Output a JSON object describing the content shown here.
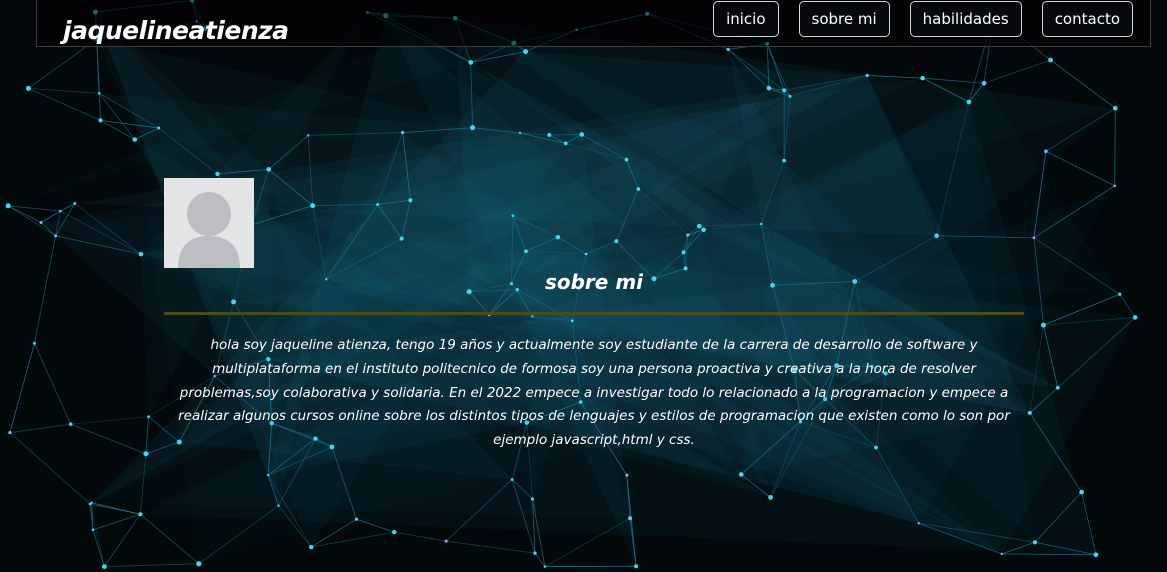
{
  "header": {
    "brand": "jaquelineatienza",
    "nav": [
      {
        "label": "inicio"
      },
      {
        "label": "sobre mi"
      },
      {
        "label": "habilidades"
      },
      {
        "label": "contacto"
      }
    ]
  },
  "about": {
    "avatar_icon": "user-avatar-icon",
    "title": "sobre mi",
    "bio": "hola soy jaqueline atienza, tengo 19 años y actualmente soy estudiante de la carrera de desarrollo de software y multiplataforma en el instituto politecnico de formosa soy una persona proactiva y creativa a la hora de resolver problemas,soy colaborativa y solidaria. En el 2022 empece a investigar todo lo relacionado a la programacion y empece a realizar algunos cursos online sobre los distintos tipos de lenguajes y estilos de programacion que existen como lo son por ejemplo javascript,html y css."
  },
  "colors": {
    "background": "#03080b",
    "network_line": "#1f7a95",
    "network_node": "#3fd8ec",
    "divider": "#4a4c1c"
  }
}
